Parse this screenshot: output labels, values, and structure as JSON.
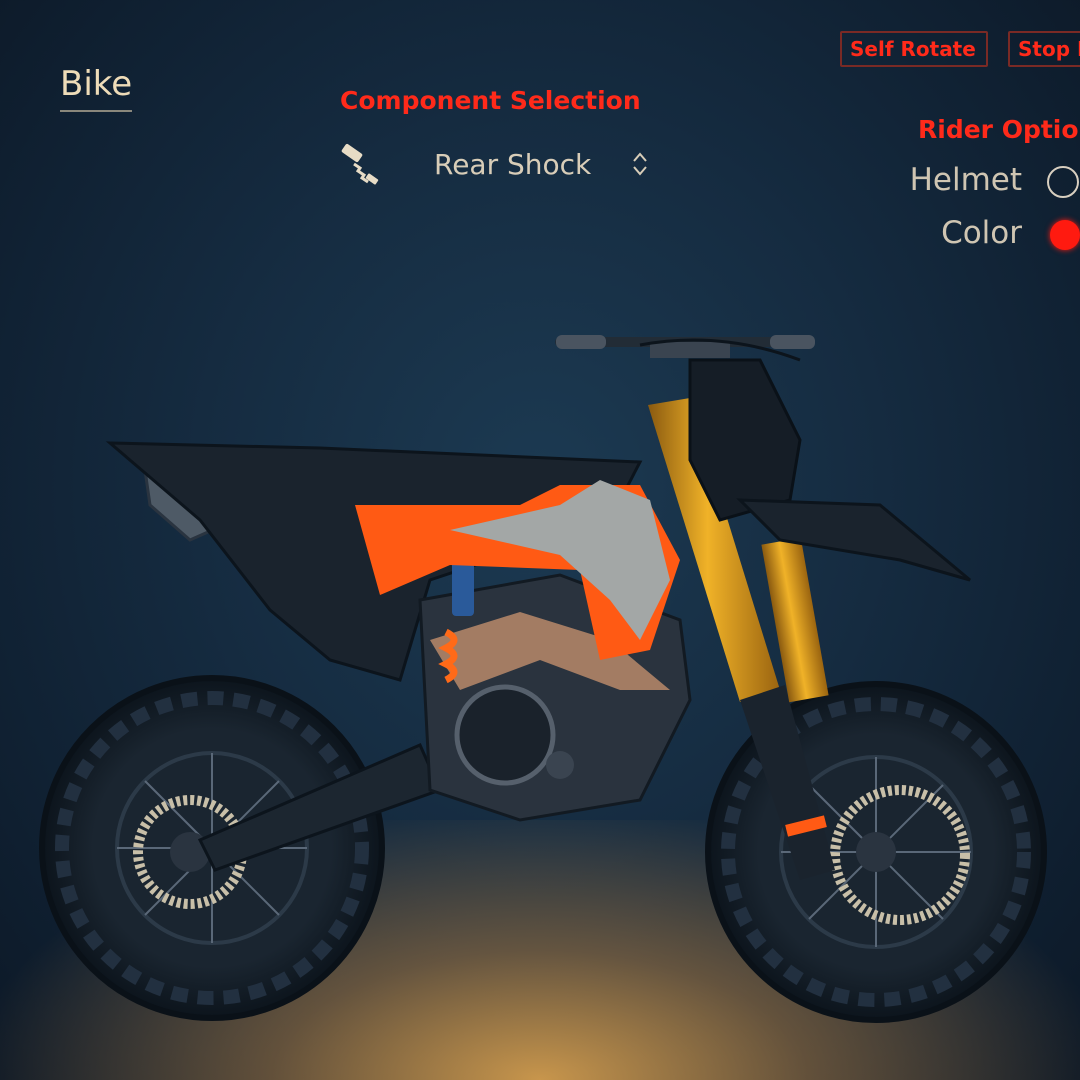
{
  "tabs": {
    "bike": "Bike"
  },
  "component_selection": {
    "title": "Component Selection",
    "selected": "Rear Shock",
    "icon": "rear-shock-icon",
    "arrows": "updown-chevron-icon"
  },
  "top_buttons": {
    "self_rotate": "Self Rotate",
    "stop": "Stop R"
  },
  "rider_options": {
    "title": "Rider Options",
    "helmet": {
      "label": "Helmet",
      "selected": false
    },
    "color": {
      "label": "Color",
      "selected": true
    }
  },
  "colors": {
    "accent_red": "#ff2a1a",
    "label_cream": "#eedcb8",
    "bike_orange": "#ff5a14",
    "fork_gold": "#e0a020"
  }
}
